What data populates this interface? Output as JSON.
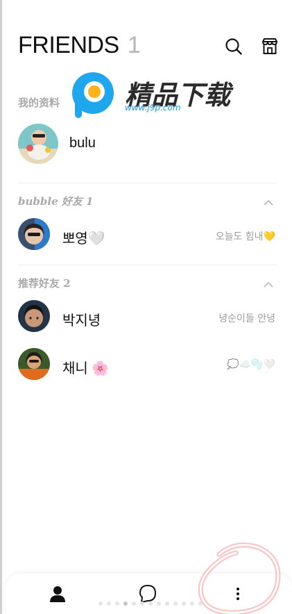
{
  "header": {
    "title": "FRIENDS",
    "count": "1"
  },
  "watermark": {
    "text": "精品下载",
    "url": "www.j9p.com"
  },
  "my_profile": {
    "section_label": "我的资料",
    "name": "bulu"
  },
  "bubble_friends": {
    "section_label": "bubble 好友 1",
    "items": [
      {
        "name": "뽀영🤍",
        "status": "오늘도 힘내💛"
      }
    ]
  },
  "recommended": {
    "section_label": "推荐好友 2",
    "items": [
      {
        "name": "박지녕",
        "status": "녕순이들 안녕"
      },
      {
        "name": "채니 🌸",
        "status": "💭☁️🫧🤍"
      }
    ]
  },
  "colors": {
    "section_text": "#a9a9a9",
    "status_text": "#9c9c9c",
    "scribble": "#ff6b6b"
  }
}
